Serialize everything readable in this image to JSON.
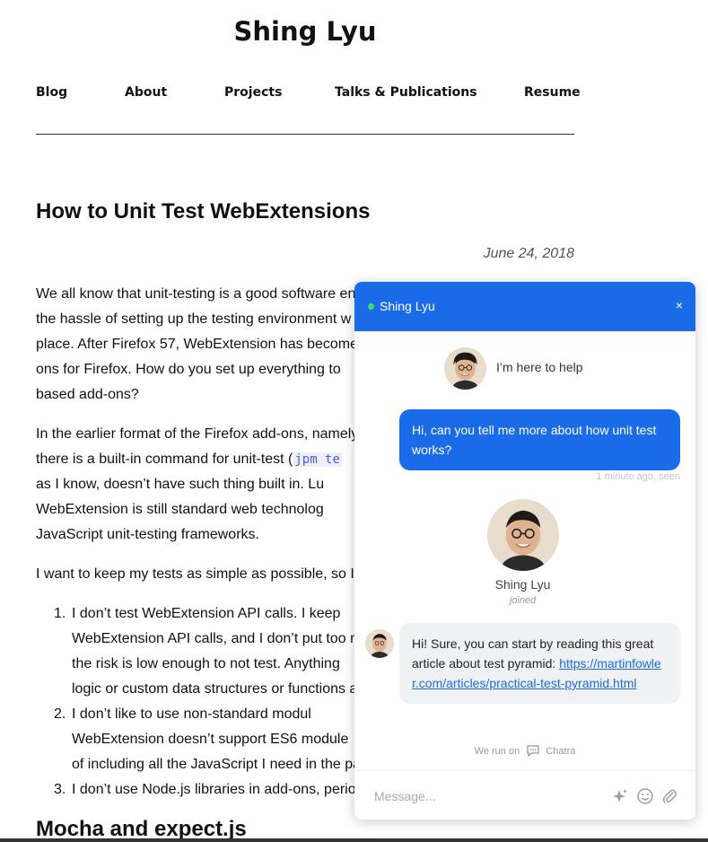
{
  "site": {
    "title": "Shing Lyu"
  },
  "nav": {
    "items": [
      "Blog",
      "About",
      "Projects",
      "Talks & Publications",
      "Resume"
    ]
  },
  "post": {
    "title": "How to Unit Test WebExtensions",
    "date": "June 24, 2018",
    "p1_lines": [
      "We all know that unit-testing is a good software en",
      "the hassle of setting up the testing environment w",
      "place. After Firefox 57, WebExtension has become",
      "ons for Firefox. How do you set up everything to",
      "based add-ons?"
    ],
    "p2_l1": "In the earlier format of the Firefox add-ons, namely",
    "p2_l2_pre": "there is a built-in command for unit-test (",
    "p2_l2_code": "jpm te",
    "p2_l3": "as I know, doesn’t have such thing built in. Lu",
    "p2_l4": "WebExtension is still standard web technolog",
    "p2_l5": "JavaScript unit-testing frameworks.",
    "p3": "I want to keep my tests as simple as possible, so I",
    "list": [
      {
        "num": "1.",
        "lines": [
          "I don’t test WebExtension API calls. I keep",
          "WebExtension API calls, and I don’t put too n",
          "the risk is low enough to not test. Anything",
          "logic or custom data structures or functions a"
        ]
      },
      {
        "num": "2.",
        "lines": [
          "I don’t like to use non-standard modul",
          "WebExtension doesn’t support ES6 module",
          "of including all the JavaScript I need in the pa"
        ]
      },
      {
        "num": "3.",
        "lines": [
          "I don’t use Node.js libraries in add-ons, period"
        ]
      }
    ],
    "next_heading": "Mocha and expect.js"
  },
  "chat": {
    "agent_name": "Shing Lyu",
    "close_label": "×",
    "help_text": "I’m here to help",
    "user_message": "Hi, can you tell me more about how unit test works?",
    "user_meta": "1 minute ago, seen",
    "joined_name": "Shing Lyu",
    "joined_tag": "joined",
    "agent_reply": "Hi! Sure, you can start by reading this great article about test pyramid:",
    "agent_link": "https://martinfowler.com/articles/practical-test-pyramid.html",
    "powered_prefix": "We run on",
    "powered_brand": "Chatra",
    "input_placeholder": "Message...",
    "accent_color": "#1a6be8",
    "online_color": "#3ddc5a",
    "icons": [
      "sparkle-icon",
      "emoji-icon",
      "paperclip-icon"
    ]
  }
}
